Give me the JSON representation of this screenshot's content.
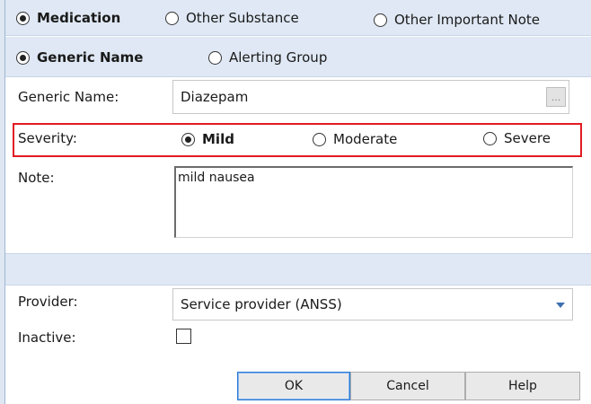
{
  "substance_type": {
    "options": [
      {
        "label": "Medication",
        "selected": true
      },
      {
        "label": "Other Substance",
        "selected": false
      },
      {
        "label": "Other Important Note",
        "selected": false
      }
    ]
  },
  "name_type": {
    "options": [
      {
        "label": "Generic Name",
        "selected": true
      },
      {
        "label": "Alerting Group",
        "selected": false
      }
    ]
  },
  "generic_name": {
    "label": "Generic Name:",
    "value": "Diazepam",
    "browse_label": "..."
  },
  "severity": {
    "label": "Severity:",
    "options": [
      {
        "label": "Mild",
        "selected": true
      },
      {
        "label": "Moderate",
        "selected": false
      },
      {
        "label": "Severe",
        "selected": false
      }
    ],
    "highlight_color": "#e21b23"
  },
  "note": {
    "label": "Note:",
    "value": "mild nausea"
  },
  "provider": {
    "label": "Provider:",
    "selected": "Service provider (ANSS)"
  },
  "inactive": {
    "label": "Inactive:",
    "checked": false
  },
  "buttons": {
    "ok": "OK",
    "cancel": "Cancel",
    "help": "Help"
  },
  "colors": {
    "band": "#dfe8f4",
    "accent": "#2c7ad4"
  }
}
